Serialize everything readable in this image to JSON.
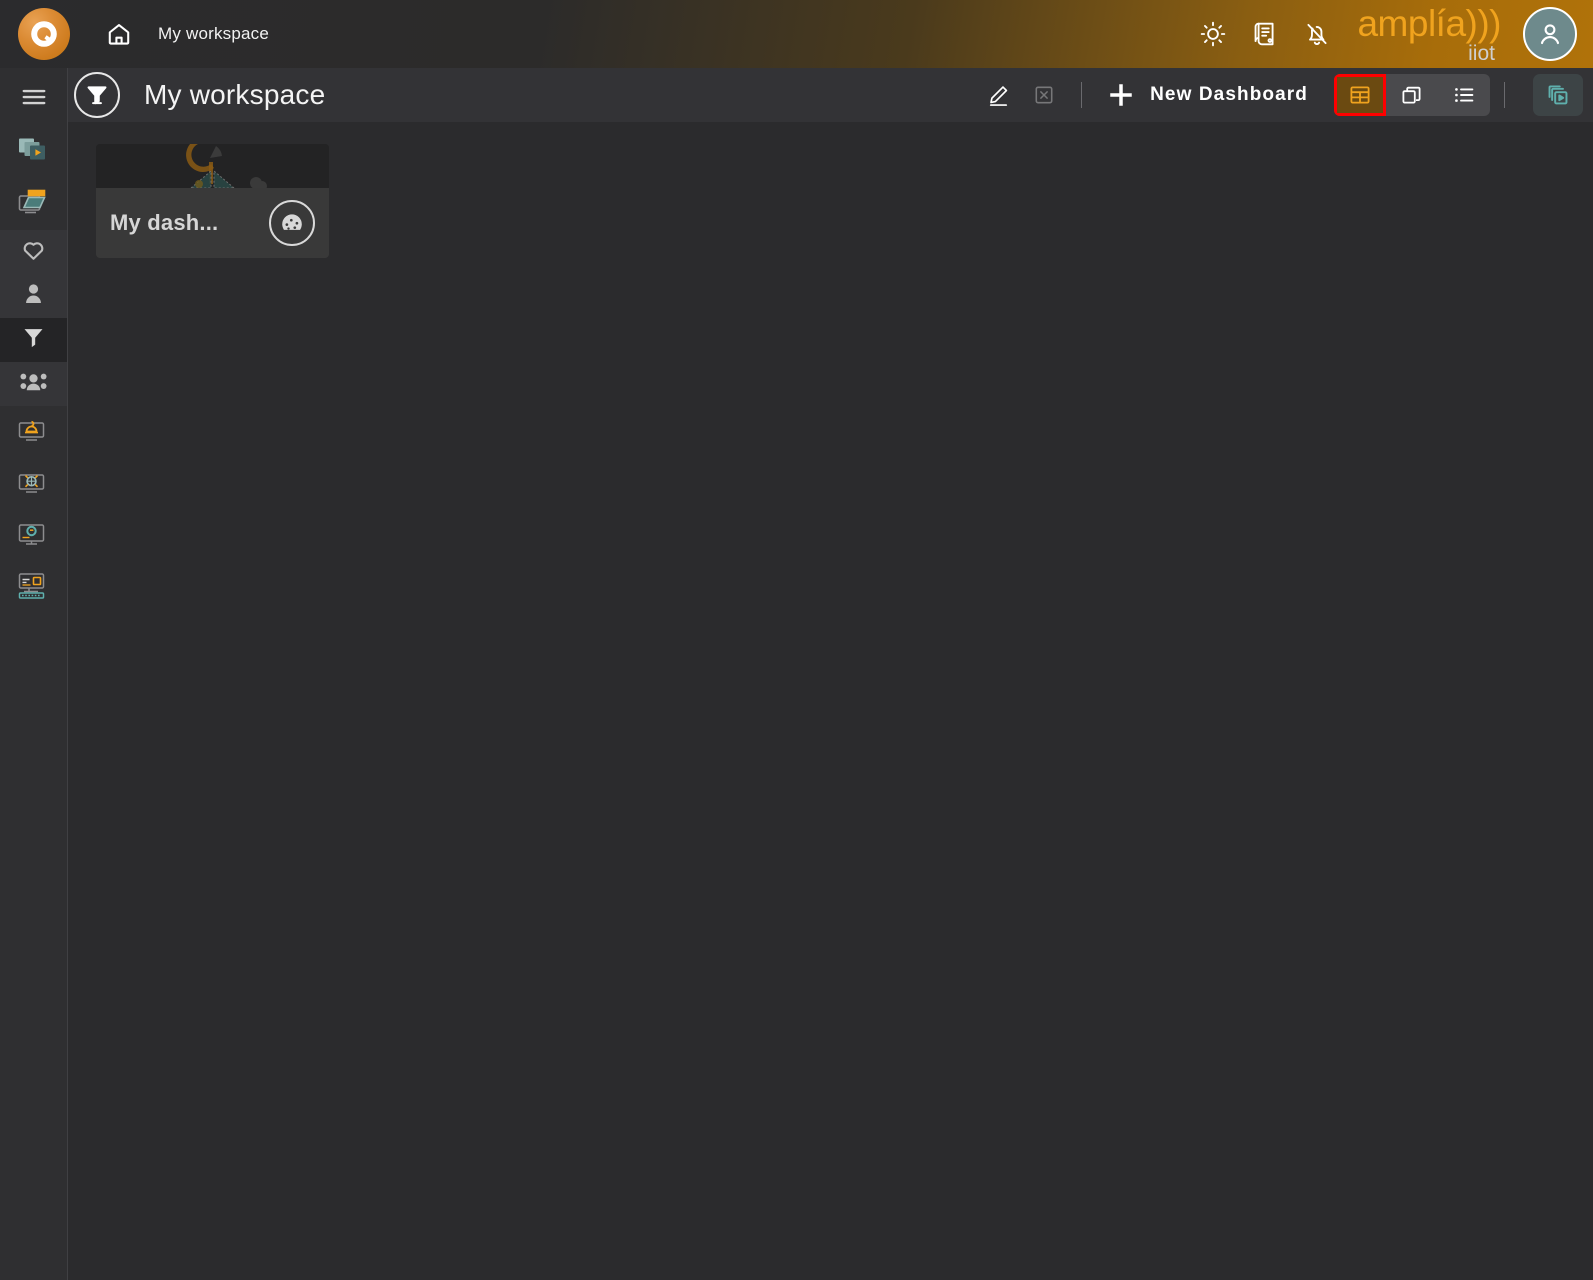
{
  "topbar": {
    "logo_name": "amplia-q-logo",
    "home_label": "home-icon",
    "workspace_label": "My workspace",
    "icons": [
      {
        "name": "brightness-icon",
        "label": "Brightness"
      },
      {
        "name": "documentation-icon",
        "label": "Documentation"
      },
      {
        "name": "notifications-muted-icon",
        "label": "Notifications muted"
      }
    ],
    "brand_main": "amplía)))",
    "brand_sub": "iiot",
    "avatar_label": "user-avatar"
  },
  "subbar": {
    "workspace_icon": "funnel-icon",
    "title": "My workspace",
    "edit_label": "Edit",
    "delete_label": "Delete",
    "new_dashboard_label": "New Dashboard",
    "views": [
      {
        "name": "grid-view",
        "label": "Grid view",
        "active": true
      },
      {
        "name": "cards-view",
        "label": "Cards view",
        "active": false
      },
      {
        "name": "list-view",
        "label": "List view",
        "active": false
      }
    ],
    "presentation_label": "Presentation mode"
  },
  "sidebar": {
    "menu_label": "Menu",
    "items": [
      {
        "name": "sidebar-item-media",
        "label": "Media"
      },
      {
        "name": "sidebar-item-devices",
        "label": "Devices"
      },
      {
        "name": "sidebar-item-favorites",
        "label": "Favorites"
      },
      {
        "name": "sidebar-item-users",
        "label": "Users"
      },
      {
        "name": "sidebar-item-workspaces",
        "label": "Workspaces"
      },
      {
        "name": "sidebar-item-groups",
        "label": "Groups"
      },
      {
        "name": "sidebar-item-alarms",
        "label": "Alarms"
      },
      {
        "name": "sidebar-item-monitoring",
        "label": "Monitoring"
      },
      {
        "name": "sidebar-item-configuration",
        "label": "Configuration"
      },
      {
        "name": "sidebar-item-console",
        "label": "Console"
      }
    ]
  },
  "content": {
    "dashboards": [
      {
        "name": "dashboard-card",
        "title": "My dash...",
        "icon": "gauge-icon"
      }
    ]
  },
  "colors": {
    "accent_orange": "#f0a31e",
    "highlight_red": "#ff0000",
    "teal": "#5fb0ad",
    "background": "#2b2b2d",
    "panel": "#333336"
  }
}
